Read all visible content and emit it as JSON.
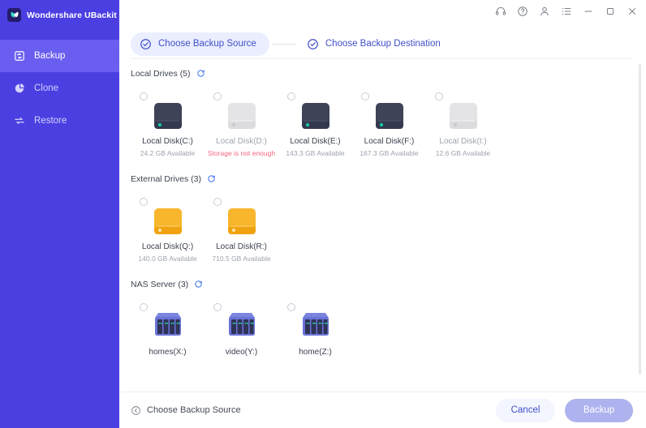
{
  "sidebar": {
    "brand": {
      "title": "Wondershare UBackit",
      "logo_icon": "butterfly-logo-icon"
    },
    "items": [
      {
        "label": "Backup",
        "icon": "backup-icon",
        "active": true
      },
      {
        "label": "Clone",
        "icon": "clone-icon",
        "active": false
      },
      {
        "label": "Restore",
        "icon": "restore-icon",
        "active": false
      }
    ]
  },
  "titlebar": {
    "icons": [
      {
        "name": "headset-support-icon"
      },
      {
        "name": "help-question-icon"
      },
      {
        "name": "user-account-icon"
      },
      {
        "name": "menu-list-icon"
      },
      {
        "name": "minimize-icon"
      },
      {
        "name": "maximize-icon"
      },
      {
        "name": "close-icon"
      }
    ]
  },
  "stepper": {
    "steps": [
      {
        "label": "Choose Backup Source",
        "state": "done"
      },
      {
        "label": "Choose Backup Destination",
        "state": "done"
      }
    ]
  },
  "sections": [
    {
      "title": "Local Drives (5)",
      "refresh_icon": "refresh-icon",
      "kind": "disk",
      "drives": [
        {
          "name": "Local Disk(C:)",
          "sub": "24.2 GB Available",
          "state": "enabled",
          "warn": false
        },
        {
          "name": "Local Disk(D:)",
          "sub": "Storage is not enough",
          "state": "disabled",
          "warn": true
        },
        {
          "name": "Local Disk(E:)",
          "sub": "143.3 GB Available",
          "state": "enabled",
          "warn": false
        },
        {
          "name": "Local Disk(F:)",
          "sub": "167.3 GB Available",
          "state": "enabled",
          "warn": false
        },
        {
          "name": "Local Disk(I:)",
          "sub": "12.6 GB Available",
          "state": "disabled",
          "warn": false
        }
      ]
    },
    {
      "title": "External Drives (3)",
      "refresh_icon": "refresh-icon",
      "kind": "external",
      "drives": [
        {
          "name": "Local Disk(Q:)",
          "sub": "140.0 GB Available",
          "state": "enabled",
          "warn": false
        },
        {
          "name": "Local Disk(R:)",
          "sub": "710.5 GB Available",
          "state": "enabled",
          "warn": false
        }
      ]
    },
    {
      "title": "NAS Server (3)",
      "refresh_icon": "refresh-icon",
      "kind": "nas",
      "drives": [
        {
          "name": "homes(X:)",
          "sub": "",
          "state": "enabled",
          "warn": false
        },
        {
          "name": "video(Y:)",
          "sub": "",
          "state": "enabled",
          "warn": false
        },
        {
          "name": "home(Z:)",
          "sub": "",
          "state": "enabled",
          "warn": false
        }
      ]
    }
  ],
  "footer": {
    "back_label": "Choose Backup Source",
    "back_icon": "chevron-left-circle-icon",
    "cancel_label": "Cancel",
    "backup_label": "Backup"
  },
  "colors": {
    "sidebar_bg": "#4b3fe2",
    "sidebar_active": "#6a5ef0",
    "accent_blue": "#4250c8",
    "step_pill": "#eaeeff",
    "warn_red": "#f2667f",
    "disk_dark": "#3f4358",
    "disk_gray": "#e2e2e2",
    "external_orange": "#f6ab1e",
    "nas_blue": "#6a74d8",
    "led_teal": "#12c9a6",
    "backup_btn": "#aeb2ee",
    "cancel_btn": "#f3f5ff"
  }
}
